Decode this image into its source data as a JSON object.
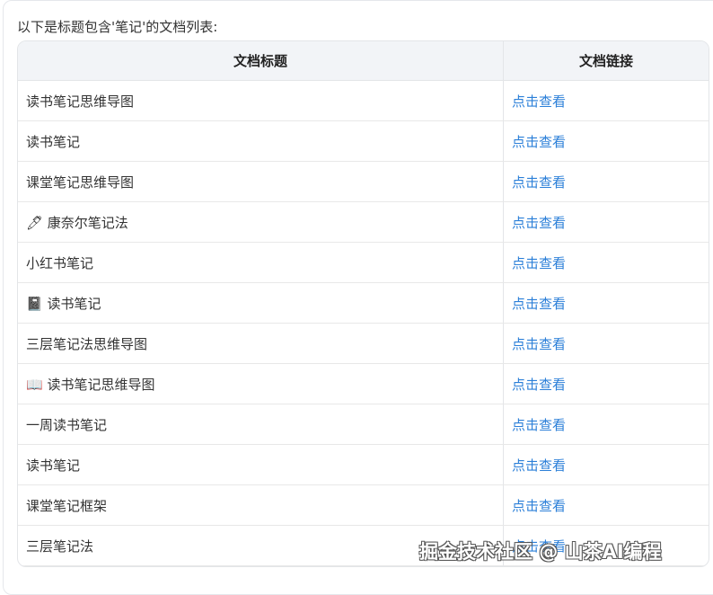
{
  "intro": "以下是标题包含'笔记'的文档列表:",
  "headers": [
    "文档标题",
    "文档链接"
  ],
  "rows": [
    {
      "title": "读书笔记思维导图",
      "link": "点击查看"
    },
    {
      "title": "读书笔记",
      "link": "点击查看"
    },
    {
      "title": "课堂笔记思维导图",
      "link": "点击查看"
    },
    {
      "title": "🖊 康奈尔笔记法",
      "link": "点击查看"
    },
    {
      "title": "小红书笔记",
      "link": "点击查看"
    },
    {
      "title": "📓 读书笔记",
      "link": "点击查看"
    },
    {
      "title": "三层笔记法思维导图",
      "link": "点击查看"
    },
    {
      "title": "📖 读书笔记思维导图",
      "link": "点击查看"
    },
    {
      "title": "一周读书笔记",
      "link": "点击查看"
    },
    {
      "title": "读书笔记",
      "link": "点击查看"
    },
    {
      "title": "课堂笔记框架",
      "link": "点击查看"
    },
    {
      "title": "三层笔记法",
      "link": "点击查看"
    }
  ],
  "watermark": "掘金技术社区 @ 山茶AI编程"
}
